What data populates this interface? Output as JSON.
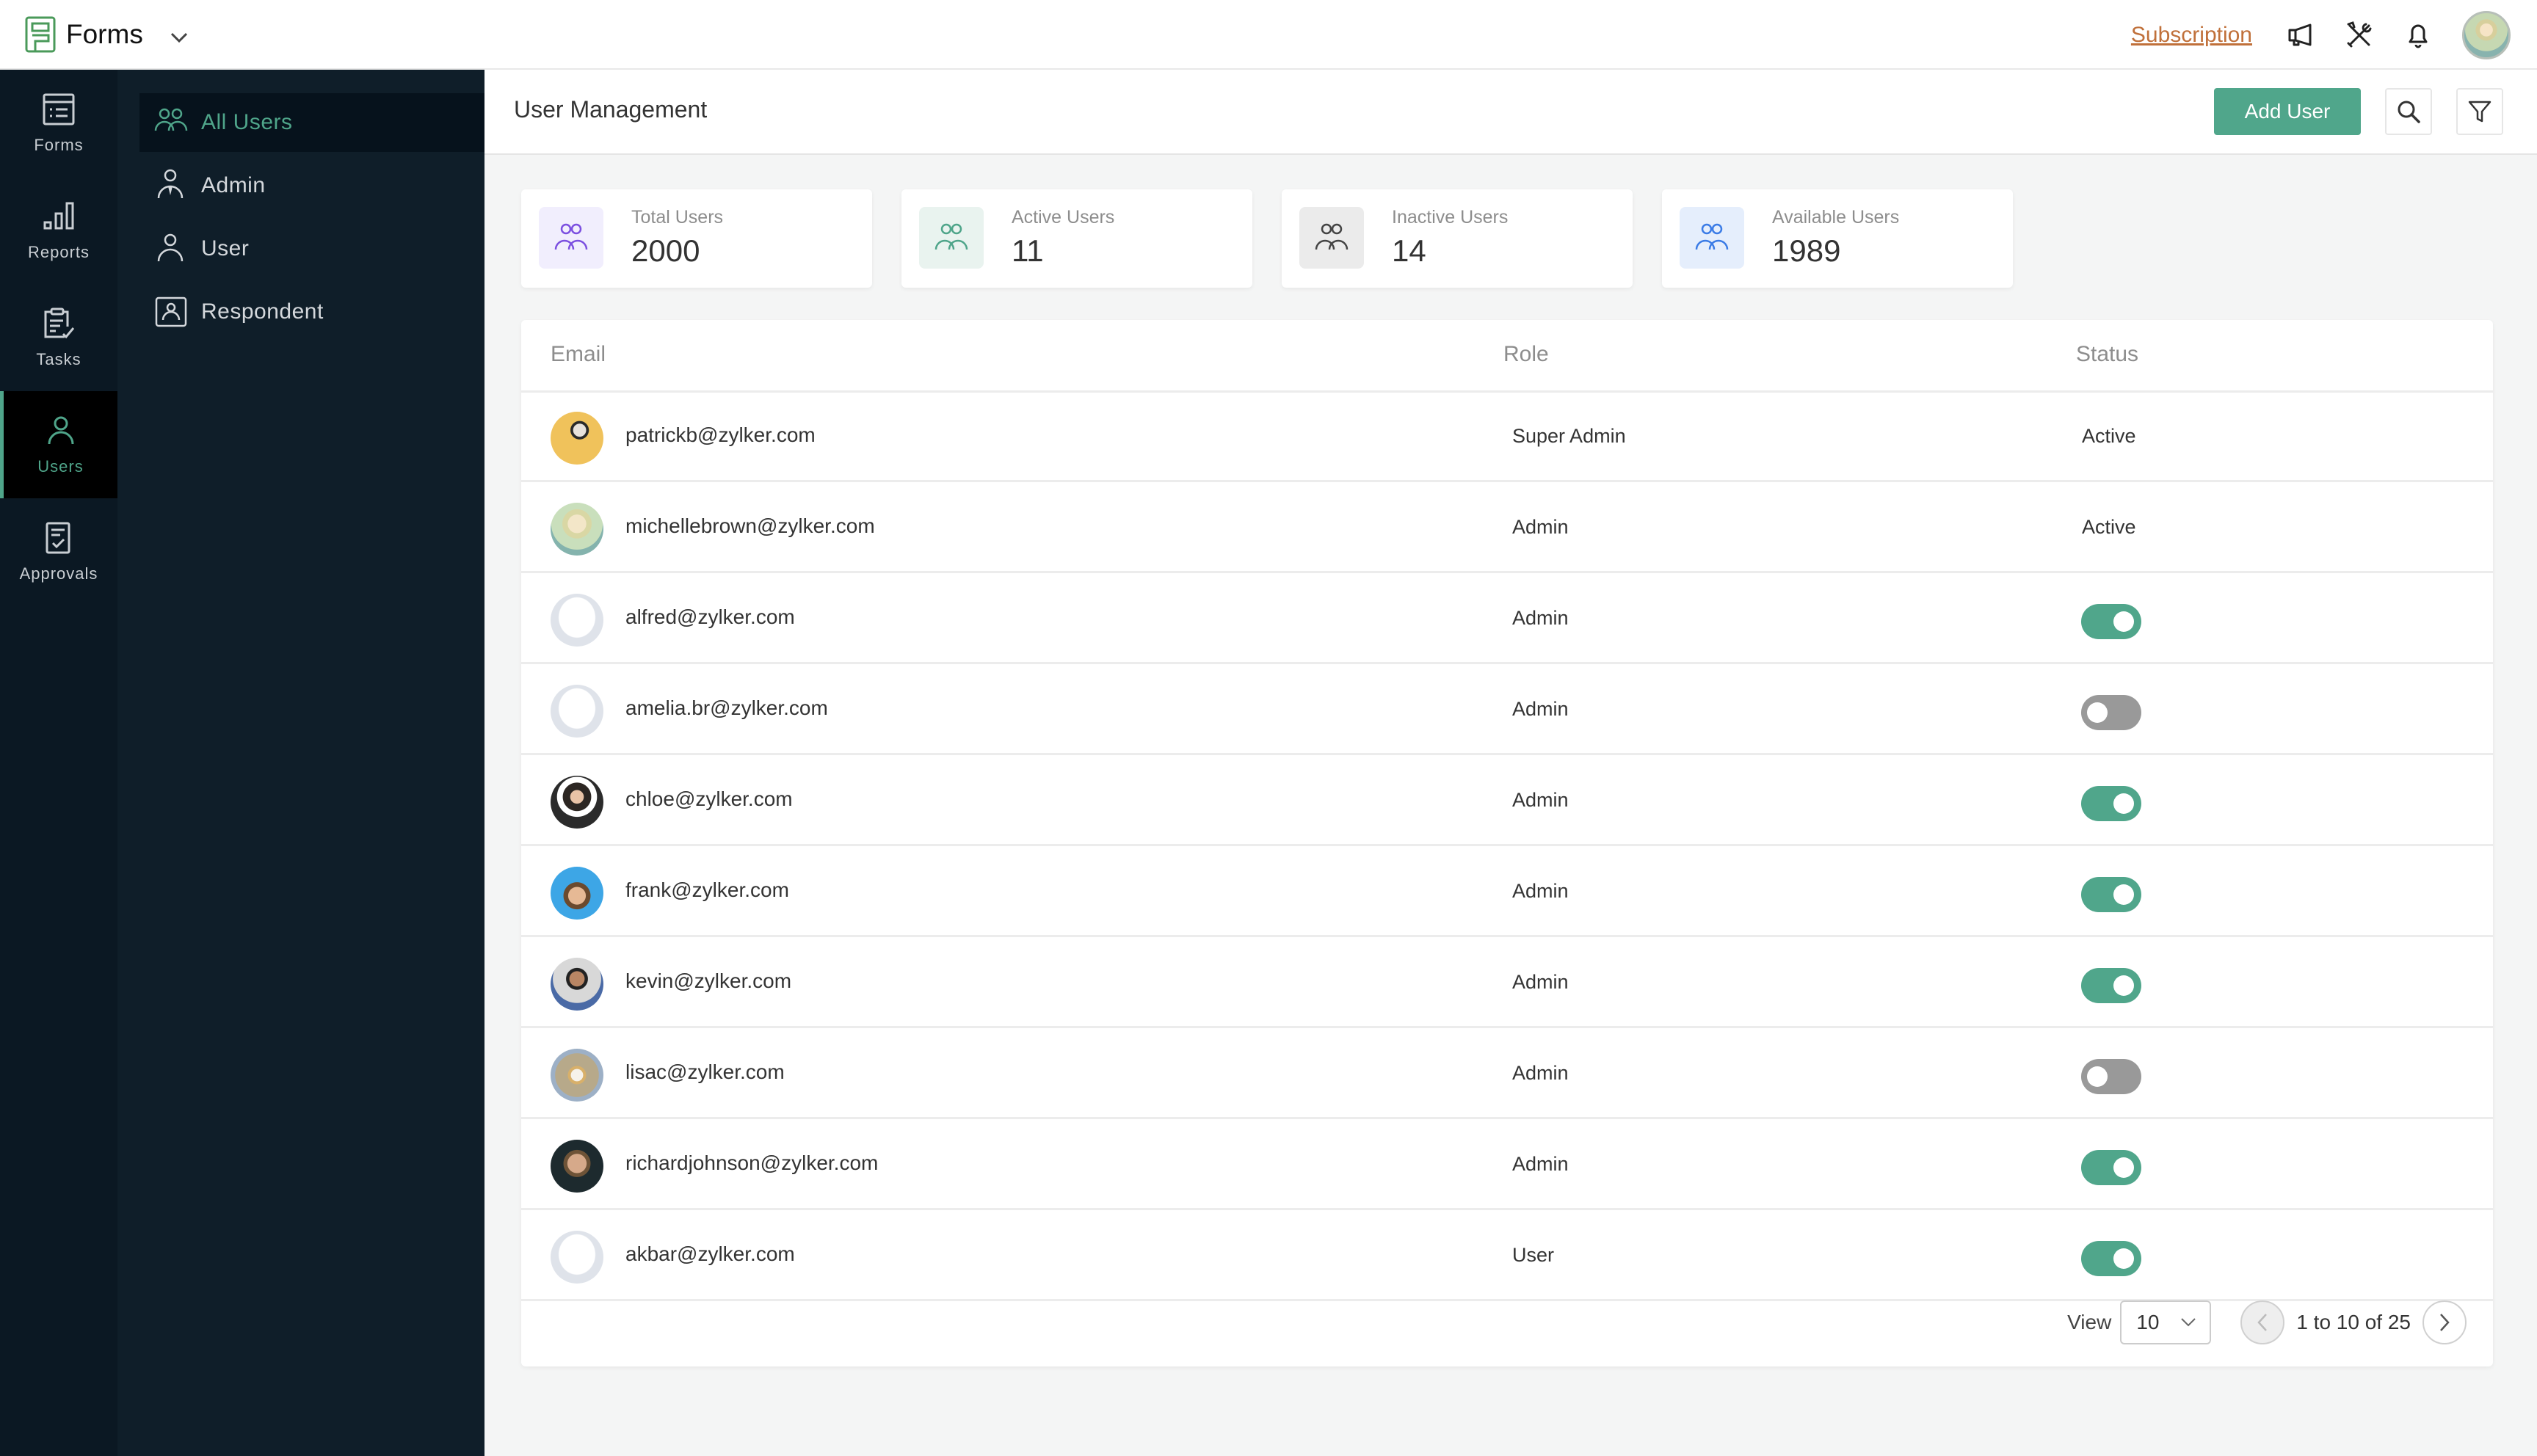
{
  "app": {
    "name": "Forms",
    "subscription_label": "Subscription",
    "brand_color": "#4a9a5a",
    "accent_color": "#50a68b",
    "link_color": "#c0703a"
  },
  "topbar_icons": [
    "announcement-icon",
    "tools-icon",
    "bell-icon",
    "user-avatar"
  ],
  "rail": {
    "items": [
      {
        "label": "Forms",
        "icon": "forms-icon",
        "active": false
      },
      {
        "label": "Reports",
        "icon": "reports-icon",
        "active": false
      },
      {
        "label": "Tasks",
        "icon": "tasks-icon",
        "active": false
      },
      {
        "label": "Users",
        "icon": "user-icon",
        "active": true
      },
      {
        "label": "Approvals",
        "icon": "approvals-icon",
        "active": false
      }
    ]
  },
  "subnav": {
    "items": [
      {
        "label": "All Users",
        "icon": "users-icon",
        "active": true
      },
      {
        "label": "Admin",
        "icon": "admin-icon",
        "active": false
      },
      {
        "label": "User",
        "icon": "user-icon",
        "active": false
      },
      {
        "label": "Respondent",
        "icon": "respondent-icon",
        "active": false
      }
    ]
  },
  "header": {
    "title": "User Management",
    "add_user_label": "Add User"
  },
  "stats": [
    {
      "label": "Total Users",
      "value": "2000",
      "color": "#7b4fe0",
      "bg": "#f1eefd"
    },
    {
      "label": "Active Users",
      "value": "11",
      "color": "#4fa58a",
      "bg": "#e9f3ef"
    },
    {
      "label": "Inactive Users",
      "value": "14",
      "color": "#444444",
      "bg": "#ebebeb"
    },
    {
      "label": "Available Users",
      "value": "1989",
      "color": "#3a7be6",
      "bg": "#e5eefc"
    }
  ],
  "table": {
    "columns": [
      "Email",
      "Role",
      "Status"
    ],
    "rows": [
      {
        "email": "patrickb@zylker.com",
        "role": "Super Admin",
        "status": "Active",
        "status_type": "text",
        "avatar": "photo-yellow"
      },
      {
        "email": "michellebrown@zylker.com",
        "role": "Admin",
        "status": "Active",
        "status_type": "text",
        "avatar": "photo-green"
      },
      {
        "email": "alfred@zylker.com",
        "role": "Admin",
        "status": "on",
        "status_type": "toggle",
        "avatar": "placeholder"
      },
      {
        "email": "amelia.br@zylker.com",
        "role": "Admin",
        "status": "off",
        "status_type": "toggle",
        "avatar": "placeholder"
      },
      {
        "email": "chloe@zylker.com",
        "role": "Admin",
        "status": "on",
        "status_type": "toggle",
        "avatar": "photo-dark-hair"
      },
      {
        "email": "frank@zylker.com",
        "role": "Admin",
        "status": "on",
        "status_type": "toggle",
        "avatar": "photo-blue"
      },
      {
        "email": "kevin@zylker.com",
        "role": "Admin",
        "status": "on",
        "status_type": "toggle",
        "avatar": "photo-gray"
      },
      {
        "email": "lisac@zylker.com",
        "role": "Admin",
        "status": "off",
        "status_type": "toggle",
        "avatar": "photo-outdoor"
      },
      {
        "email": "richardjohnson@zylker.com",
        "role": "Admin",
        "status": "on",
        "status_type": "toggle",
        "avatar": "photo-dark"
      },
      {
        "email": "akbar@zylker.com",
        "role": "User",
        "status": "on",
        "status_type": "toggle",
        "avatar": "placeholder"
      }
    ]
  },
  "pagination": {
    "view_label": "View",
    "page_size": "10",
    "range_text": "1 to 10 of 25",
    "prev_disabled": true
  }
}
